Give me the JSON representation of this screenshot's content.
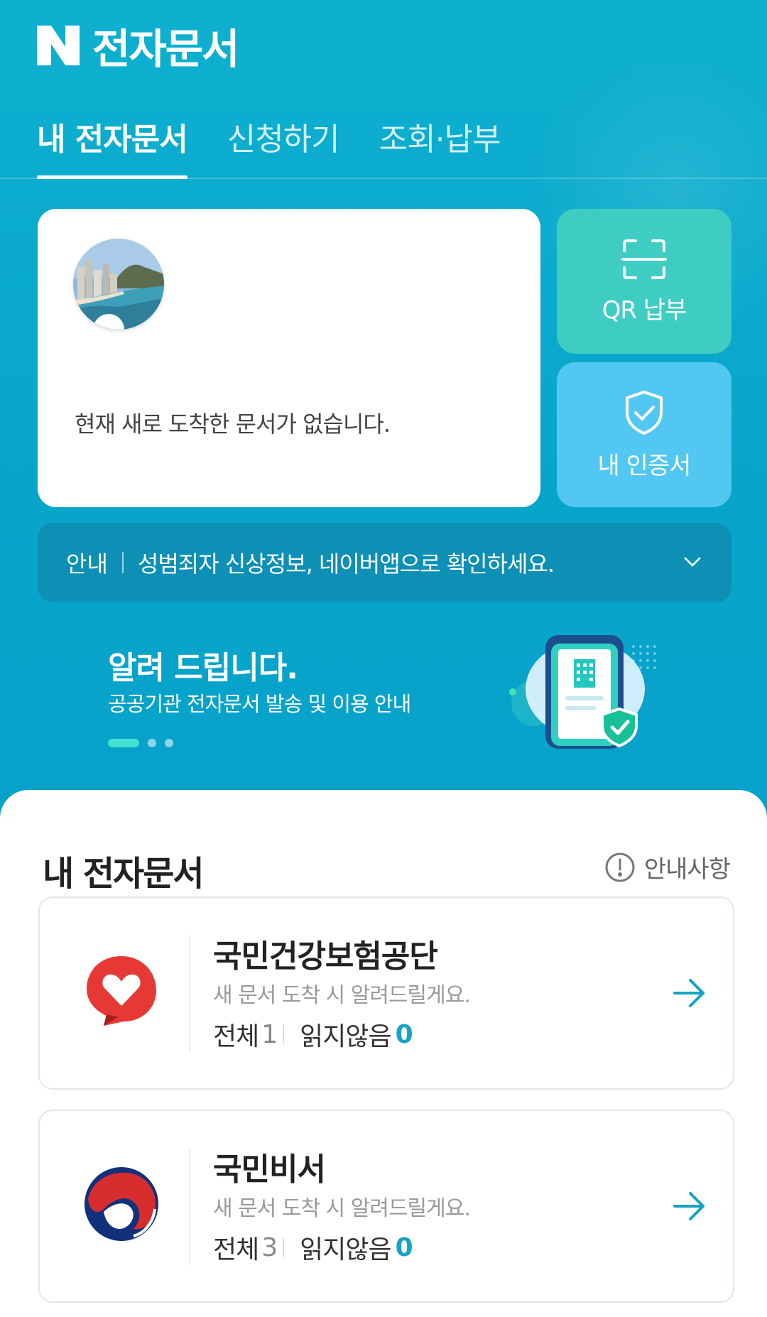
{
  "header": {
    "title": "전자문서",
    "logo_icon": "naver-n-icon"
  },
  "tabs": [
    {
      "label": "내 전자문서",
      "active": true
    },
    {
      "label": "신청하기",
      "active": false
    },
    {
      "label": "조회·납부",
      "active": false
    }
  ],
  "profile": {
    "message": "현재 새로 도착한 문서가 없습니다."
  },
  "quick_actions": {
    "qr": {
      "label": "QR 납부",
      "icon": "qr-scan-icon"
    },
    "cert": {
      "label": "내 인증서",
      "icon": "shield-check-icon"
    }
  },
  "notice": {
    "tag": "안내",
    "text": "성범죄자 신상정보, 네이버앱으로 확인하세요."
  },
  "promo": {
    "title": "알려 드립니다.",
    "subtitle": "공공기관 전자문서 발송 및 이용 안내",
    "slides_total": 3,
    "slide_active": 1
  },
  "documents_section": {
    "title": "내 전자문서",
    "notice_link": "안내사항",
    "items": [
      {
        "name": "국민건강보험공단",
        "desc": "새 문서 도착 시 알려드릴게요.",
        "total_label": "전체",
        "total": "1",
        "unread_label": "읽지않음",
        "unread": "0",
        "icon": "nhis-heart-logo-icon"
      },
      {
        "name": "국민비서",
        "desc": "새 문서 도착 시 알려드릴게요.",
        "total_label": "전체",
        "total": "3",
        "unread_label": "읽지않음",
        "unread": "0",
        "icon": "taegeuk-logo-icon"
      }
    ]
  },
  "colors": {
    "primary": "#0aa6c9",
    "accent_teal": "#3fcdc3",
    "accent_sky": "#52c7f2",
    "unread": "#14a3c7"
  }
}
